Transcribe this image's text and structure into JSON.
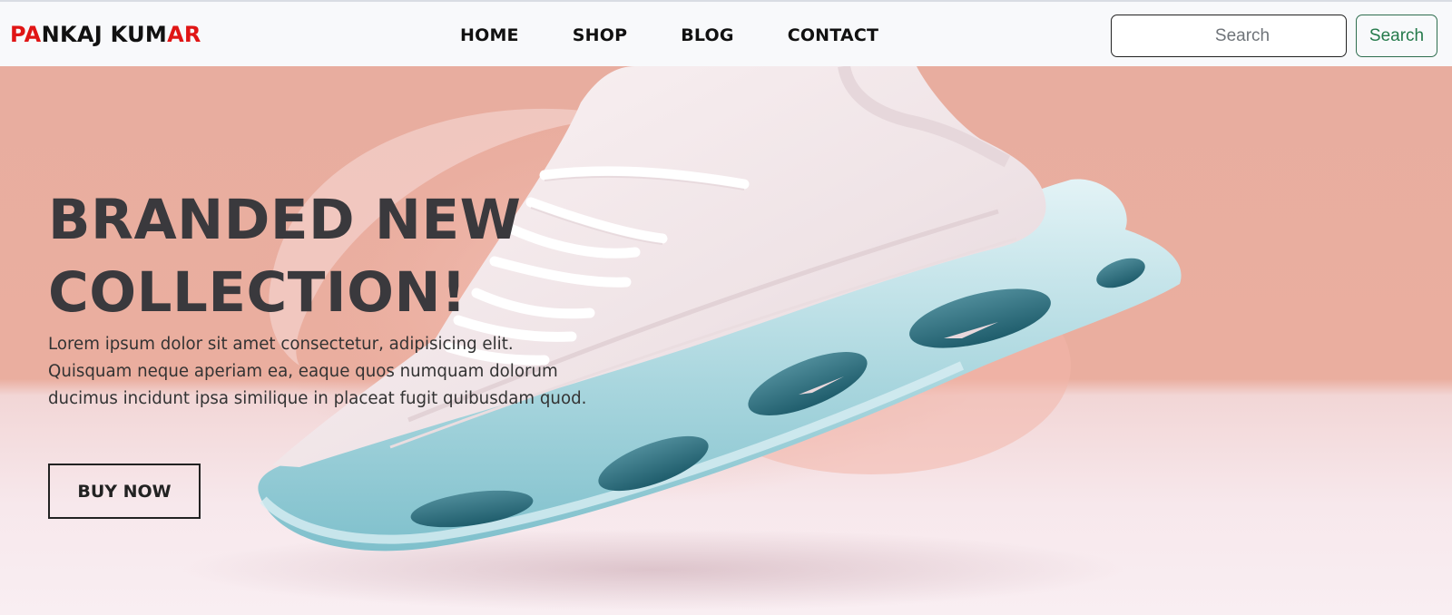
{
  "brand": {
    "parts": [
      {
        "text": "PA",
        "accent": true
      },
      {
        "text": "NKAJ KUM",
        "accent": false
      },
      {
        "text": "AR",
        "accent": true
      }
    ],
    "accent_color": "#e01515"
  },
  "nav": {
    "links": [
      "HOME",
      "SHOP",
      "BLOG",
      "CONTACT"
    ]
  },
  "search": {
    "placeholder": "Search",
    "button_label": "Search"
  },
  "hero": {
    "title_line1": "BRANDED NEW",
    "title_line2": "COLLECTION!",
    "text_line1": "Lorem ipsum dolor sit amet consectetur, adipisicing elit.",
    "text_line2": "Quisquam neque aperiam ea, eaque quos numquam dolorum",
    "text_line3": "ducimus incidunt ipsa similique in placeat fugit quibusdam quod.",
    "button_label": "BUY NOW"
  }
}
